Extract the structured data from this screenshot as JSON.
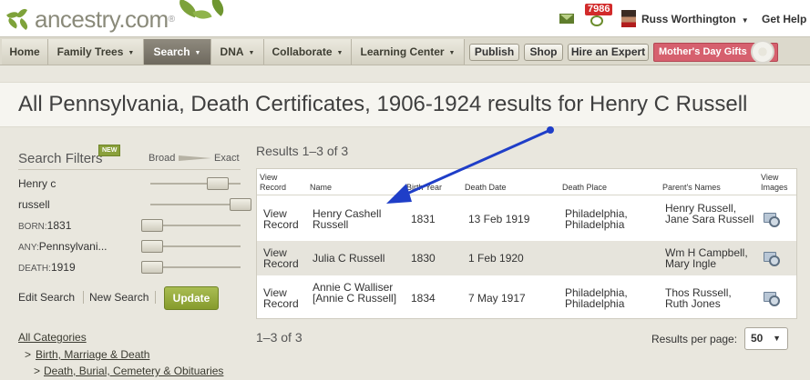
{
  "brand": {
    "logo_text": "ancestry.com",
    "logo_tm": "®"
  },
  "header": {
    "notification_count": "7986",
    "user_name": "Russ Worthington",
    "help_label": "Get Help"
  },
  "nav": {
    "items": [
      {
        "label": "Home"
      },
      {
        "label": "Family Trees"
      },
      {
        "label": "Search"
      },
      {
        "label": "DNA"
      },
      {
        "label": "Collaborate"
      },
      {
        "label": "Learning Center"
      }
    ],
    "buttons": [
      {
        "label": "Publish"
      },
      {
        "label": "Shop"
      },
      {
        "label": "Hire an Expert"
      }
    ],
    "promo_label": "Mother's Day Gifts"
  },
  "page": {
    "title": "All Pennsylvania, Death Certificates, 1906-1924 results for Henry C Russell"
  },
  "filters": {
    "heading": "Search Filters",
    "new_badge": "NEW",
    "broad_label": "Broad",
    "exact_label": "Exact",
    "rows": [
      {
        "prefix": "",
        "value": "Henry c"
      },
      {
        "prefix": "",
        "value": "russell"
      },
      {
        "prefix": "BORN:",
        "value": "1831"
      },
      {
        "prefix": "ANY:",
        "value": "Pennsylvani..."
      },
      {
        "prefix": "DEATH:",
        "value": "1919"
      }
    ],
    "edit_search": "Edit Search",
    "new_search": "New Search",
    "update_label": "Update",
    "categories": {
      "all": "All Categories",
      "level1_marker": ">",
      "level1": "Birth, Marriage & Death",
      "level2_marker": ">",
      "level2": "Death, Burial, Cemetery & Obituaries"
    }
  },
  "results": {
    "heading": "Results 1–3 of 3",
    "columns": [
      "View Record",
      "Name",
      "Birth Year",
      "Death Date",
      "Death Place",
      "Parent's Names",
      "View Images"
    ],
    "rows": [
      {
        "view": "View Record",
        "name": "Henry Cashell Russell",
        "birth": "1831",
        "death_date": "13 Feb 1919",
        "death_place": "Philadelphia, Philadelphia",
        "parents": "Henry Russell, Jane Sara Russell"
      },
      {
        "view": "View Record",
        "name": "Julia C Russell",
        "birth": "1830",
        "death_date": "1 Feb 1920",
        "death_place": "",
        "parents": "Wm H Campbell, Mary Ingle"
      },
      {
        "view": "View Record",
        "name": "Annie C Walliser [Annie C Russell]",
        "birth": "1834",
        "death_date": "7 May 1917",
        "death_place": "Philadelphia, Philadelphia",
        "parents": "Thos Russell, Ruth Jones"
      }
    ],
    "footer_count": "1–3 of 3",
    "per_page_label": "Results per page:",
    "per_page_value": "50"
  },
  "colors": {
    "nav_active": "#7d786d",
    "update_button": "#95aa3a",
    "promo": "#d6606e",
    "annotation_arrow": "#1f3ec8"
  }
}
